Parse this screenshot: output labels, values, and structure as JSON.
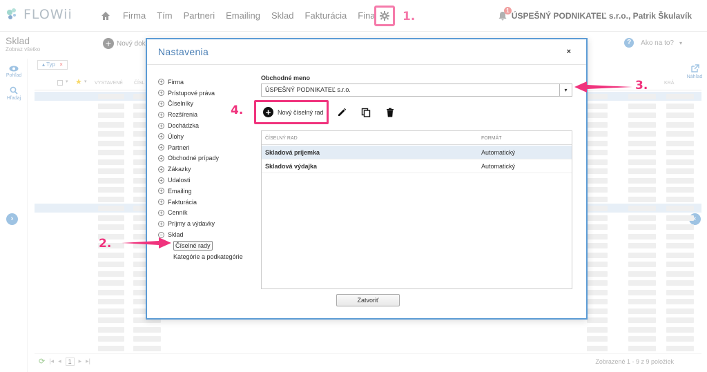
{
  "app": {
    "logo": "FLOWii"
  },
  "nav": {
    "items": [
      "Firma",
      "Tím",
      "Partneri",
      "Emailing",
      "Sklad",
      "Fakturácia",
      "Financie"
    ]
  },
  "user": {
    "notification_count": "1",
    "name": "ÚSPEŠNÝ PODNIKATEĽ s.r.o., Patrik Škulavík"
  },
  "annotations": {
    "a1": "1.",
    "a2": "2.",
    "a3": "3.",
    "a4": "4."
  },
  "page": {
    "title": "Sklad",
    "subtitle": "Zobraz všetko",
    "new_doc": "Nový doklad",
    "help": "Ako na to?",
    "left_view": "Pohľad",
    "left_search": "Hľadaj",
    "right_preview": "Náhľad",
    "filter_chip": "Typ",
    "col_issued": "VYSTAVENÉ",
    "col_number": "ČÍSL",
    "col_right": "KRÁ",
    "pager_page": "1",
    "footer_count": "Zobrazené 1 - 9 z 9 položiek"
  },
  "modal": {
    "title": "Nastavenia",
    "close_label": "×",
    "tree": [
      "Firma",
      "Prístupové práva",
      "Číselníky",
      "Rozšírenia",
      "Dochádzka",
      "Úlohy",
      "Partneri",
      "Obchodné prípady",
      "Zákazky",
      "Udalosti",
      "Emailing",
      "Fakturácia",
      "Cenník",
      "Príjmy a výdavky"
    ],
    "tree_open": "Sklad",
    "tree_sub": [
      "Číselné rady",
      "Kategórie a podkategórie"
    ],
    "field_label": "Obchodné meno",
    "company_select": "ÚSPEŠNÝ PODNIKATEĽ s.r.o.",
    "new_series": "Nový číselný rad",
    "grid_headers": [
      "ČÍSELNÝ RAD",
      "FORMÁT"
    ],
    "grid_rows": [
      {
        "name": "Skladová príjemka",
        "format": "Automatický"
      },
      {
        "name": "Skladová výdajka",
        "format": "Automatický"
      }
    ],
    "close_button": "Zatvoriť"
  },
  "colors": {
    "accent": "#f0337d",
    "primary": "#5b9bd5"
  }
}
